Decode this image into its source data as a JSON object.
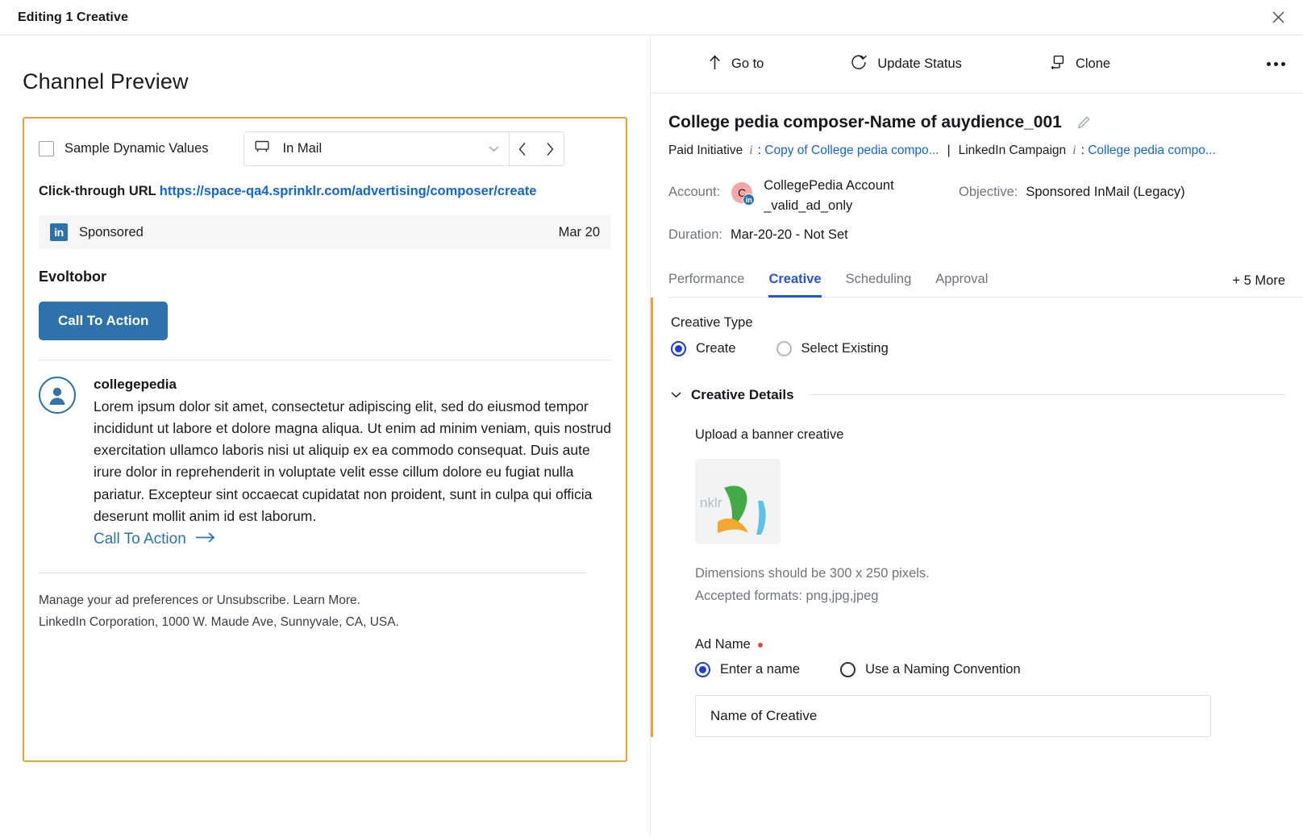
{
  "window": {
    "title": "Editing 1 Creative",
    "close_icon": "close-icon"
  },
  "left_pane": {
    "heading": "Channel Preview",
    "sample_dynamic_values_label": "Sample Dynamic Values",
    "sample_dynamic_values_checked": false,
    "channel_select": {
      "icon": "in-mail-icon",
      "value": "In Mail",
      "chevron": "chevron-down-icon"
    },
    "nav": {
      "prev_icon": "chevron-left-icon",
      "next_icon": "chevron-right-icon"
    },
    "click_through": {
      "label": "Click-through URL",
      "url": "https://space-qa4.sprinklr.com/advertising/composer/create"
    },
    "preview": {
      "network_badge": "in",
      "sponsored_label": "Sponsored",
      "date": "Mar 20",
      "headline": "Evoltobor",
      "cta_button_label": "Call To Action",
      "sender": "collegepedia",
      "message": "Lorem ipsum dolor sit amet, consectetur adipiscing elit, sed do eiusmod tempor incididunt ut labore et dolore magna aliqua. Ut enim ad minim veniam, quis nostrud exercitation ullamco laboris nisi ut aliquip ex ea commodo consequat. Duis aute irure dolor in reprehenderit in voluptate velit esse cillum dolore eu fugiat nulla pariatur. Excepteur sint occaecat cupidatat non proident, sunt in culpa qui officia deserunt mollit anim id est laborum.",
      "message_cta": "Call To Action",
      "message_cta_icon": "arrow-right-icon",
      "footer_line1": "Manage your ad preferences or Unsubscribe. Learn More.",
      "footer_line2": "LinkedIn Corporation, 1000 W. Maude Ave, Sunnyvale, CA, USA."
    }
  },
  "right_pane": {
    "actions": [
      {
        "label": "Go to",
        "icon": "arrow-up-icon"
      },
      {
        "label": "Update Status",
        "icon": "refresh-check-icon"
      },
      {
        "label": "Clone",
        "icon": "clone-icon"
      }
    ],
    "overflow_icon": "more-horizontal-icon",
    "record_title": "College pedia composer-Name of auydience_001",
    "edit_icon": "pencil-icon",
    "meta": {
      "paid_initiative_label": "Paid Initiative",
      "paid_initiative_value": "Copy of College pedia compo...",
      "separator": "|",
      "campaign_label": "LinkedIn Campaign",
      "campaign_value": "College pedia compo...",
      "colon": ":"
    },
    "details": {
      "account_label": "Account:",
      "account_avatar_letter": "C",
      "account_name_line1": "CollegePedia Account",
      "account_name_line2": "_valid_ad_only",
      "objective_label": "Objective:",
      "objective_value": "Sponsored InMail (Legacy)",
      "duration_label": "Duration:",
      "duration_value": "Mar-20-20 - Not Set"
    },
    "tabs": [
      {
        "label": "Performance",
        "active": false
      },
      {
        "label": "Creative",
        "active": true
      },
      {
        "label": "Scheduling",
        "active": false
      },
      {
        "label": "Approval",
        "active": false
      }
    ],
    "more_tabs_label": "+ 5 More",
    "form": {
      "creative_type_label": "Creative Type",
      "creative_type_options": [
        {
          "label": "Create",
          "selected": true
        },
        {
          "label": "Select Existing",
          "selected": false
        }
      ],
      "creative_details_title": "Creative Details",
      "creative_details_caret": "chevron-down-icon",
      "upload_label": "Upload a banner creative",
      "thumbnail_text": "nklr",
      "hint_line1": "Dimensions should be 300 x 250 pixels.",
      "hint_line2": "Accepted formats: png,jpg,jpeg",
      "ad_name_label": "Ad Name",
      "ad_name_required": true,
      "ad_name_options": [
        {
          "label": "Enter a name",
          "selected": true
        },
        {
          "label": "Use a Naming Convention",
          "selected": false
        }
      ],
      "name_input_placeholder": "Name of Creative",
      "name_input_value": ""
    }
  },
  "colors": {
    "accent_orange": "#e8a33d",
    "link_blue": "#1565d8",
    "tab_blue": "#2553e8",
    "linkedin_blue": "#2d72ab",
    "required_red": "#ef4b3b"
  }
}
